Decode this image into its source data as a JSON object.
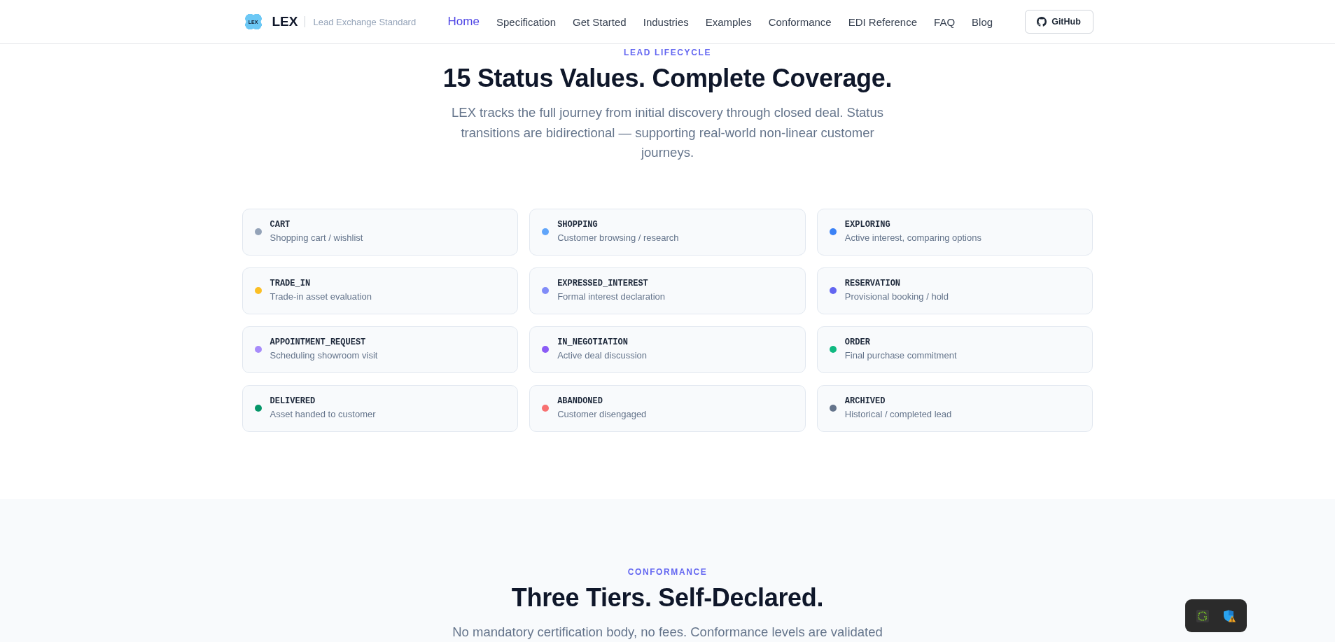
{
  "header": {
    "logo_text": "LEX",
    "brand": "LEX",
    "tagline": "Lead Exchange Standard",
    "nav": [
      {
        "label": "Home",
        "selected": true
      },
      {
        "label": "Specification",
        "selected": false
      },
      {
        "label": "Get Started",
        "selected": false
      },
      {
        "label": "Industries",
        "selected": false
      },
      {
        "label": "Examples",
        "selected": false
      },
      {
        "label": "Conformance",
        "selected": false
      },
      {
        "label": "EDI Reference",
        "selected": false
      },
      {
        "label": "FAQ",
        "selected": false
      },
      {
        "label": "Blog",
        "selected": false
      }
    ],
    "github_button": "GitHub"
  },
  "lifecycle": {
    "eyebrow": "LEAD LIFECYCLE",
    "title": "15 Status Values. Complete Coverage.",
    "description": "LEX tracks the full journey from initial discovery through closed deal. Status transitions are bidirectional — supporting real-world non-linear customer journeys.",
    "statuses": [
      {
        "name": "CART",
        "description": "Shopping cart / wishlist",
        "color": "#94a3b8"
      },
      {
        "name": "SHOPPING",
        "description": "Customer browsing / research",
        "color": "#60a5fa"
      },
      {
        "name": "EXPLORING",
        "description": "Active interest, comparing options",
        "color": "#3b82f6"
      },
      {
        "name": "TRADE_IN",
        "description": "Trade-in asset evaluation",
        "color": "#fbbf24"
      },
      {
        "name": "EXPRESSED_INTEREST",
        "description": "Formal interest declaration",
        "color": "#818cf8"
      },
      {
        "name": "RESERVATION",
        "description": "Provisional booking / hold",
        "color": "#6366f1"
      },
      {
        "name": "APPOINTMENT_REQUEST",
        "description": "Scheduling showroom visit",
        "color": "#a78bfa"
      },
      {
        "name": "IN_NEGOTIATION",
        "description": "Active deal discussion",
        "color": "#8b5cf6"
      },
      {
        "name": "ORDER",
        "description": "Final purchase commitment",
        "color": "#10b981"
      },
      {
        "name": "DELIVERED",
        "description": "Asset handed to customer",
        "color": "#059669"
      },
      {
        "name": "ABANDONED",
        "description": "Customer disengaged",
        "color": "#f87171"
      },
      {
        "name": "ARCHIVED",
        "description": "Historical / completed lead",
        "color": "#64748b"
      }
    ]
  },
  "conformance": {
    "eyebrow": "CONFORMANCE",
    "title": "Three Tiers. Self-Declared.",
    "description": "No mandatory certification body, no fees. Conformance levels are validated"
  }
}
